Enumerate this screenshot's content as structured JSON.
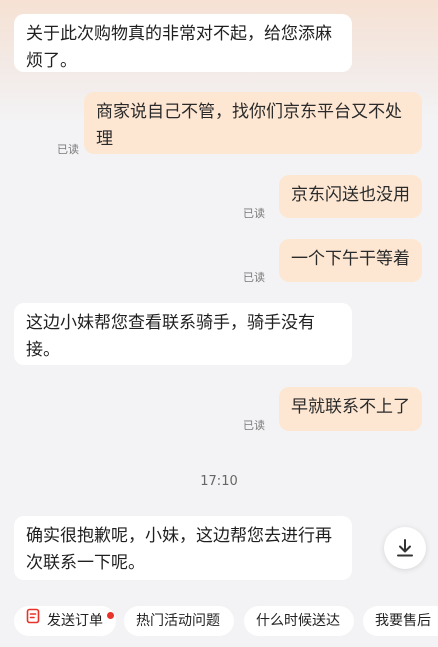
{
  "messages": [
    {
      "side": "in",
      "text": "关于此次购物真的非常对不起，给您添麻烦了。"
    },
    {
      "side": "out",
      "text": "商家说自己不管，找你们京东平台又不处理",
      "status": "已读"
    },
    {
      "side": "out",
      "text": "京东闪送也没用",
      "status": "已读"
    },
    {
      "side": "out",
      "text": "一个下午干等着",
      "status": "已读"
    },
    {
      "side": "in",
      "text": "这边小妹帮您查看联系骑手，骑手没有接。"
    },
    {
      "side": "out",
      "text": "早就联系不上了",
      "status": "已读"
    },
    {
      "side": "in",
      "text": "确实很抱歉呢，小妹，这边帮您去进行再次联系一下呢。"
    }
  ],
  "timestamp": "17:10",
  "quick_replies": [
    {
      "label": "发送订单",
      "icon": "order-icon",
      "has_dot": true
    },
    {
      "label": "热门活动问题"
    },
    {
      "label": "什么时候送达"
    },
    {
      "label": "我要售后"
    }
  ],
  "colors": {
    "outgoing_bubble": "#fde7d3",
    "incoming_bubble": "#ffffff",
    "background": "#f3f3f5",
    "accent": "#e8332a"
  },
  "icons": {
    "scroll_down": "arrow-down-to-line-icon"
  }
}
